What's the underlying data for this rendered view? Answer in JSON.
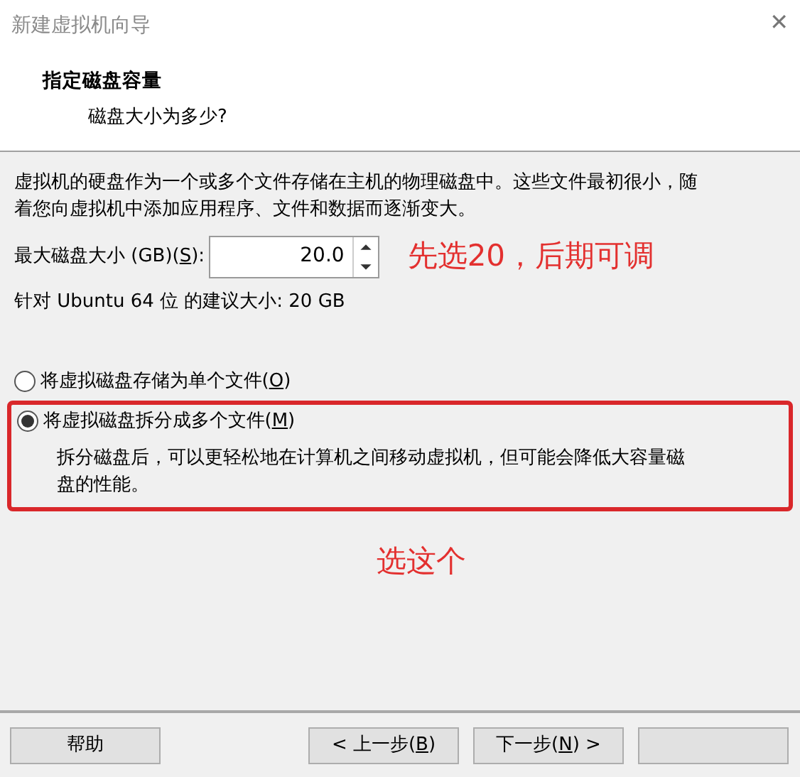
{
  "window": {
    "title": "新建虚拟机向导",
    "close_glyph": "✕"
  },
  "header": {
    "title": "指定磁盘容量",
    "subtitle": "磁盘大小为多少?"
  },
  "description": "虚拟机的硬盘作为一个或多个文件存储在主机的物理磁盘中。这些文件最初很小，随着您向虚拟机中添加应用程序、文件和数据而逐渐变大。",
  "size_field": {
    "label_before": "最大磁盘大小 (GB)(",
    "access_key": "S",
    "label_after": "):",
    "value": "20.0"
  },
  "recommendation": "针对 Ubuntu 64 位 的建议大小: 20 GB",
  "options": [
    {
      "label_before": "将虚拟磁盘存储为单个文件(",
      "access_key": "O",
      "label_after": ")",
      "selected": false,
      "highlighted": false
    },
    {
      "label_before": "将虚拟磁盘拆分成多个文件(",
      "access_key": "M",
      "label_after": ")",
      "selected": true,
      "highlighted": true,
      "note": "拆分磁盘后，可以更轻松地在计算机之间移动虚拟机，但可能会降低大容量磁盘的性能。"
    }
  ],
  "annotations": [
    "先选20，后期可调",
    "选这个"
  ],
  "buttons": [
    {
      "label_before": "帮助",
      "kind": "help"
    },
    {
      "label_before": "< 上一步(",
      "access_key": "B",
      "label_after": ")",
      "kind": "nav"
    },
    {
      "label_before": "下一步(",
      "access_key": "N",
      "label_after": ") >",
      "kind": "nav"
    },
    {
      "kind": "blank"
    }
  ]
}
